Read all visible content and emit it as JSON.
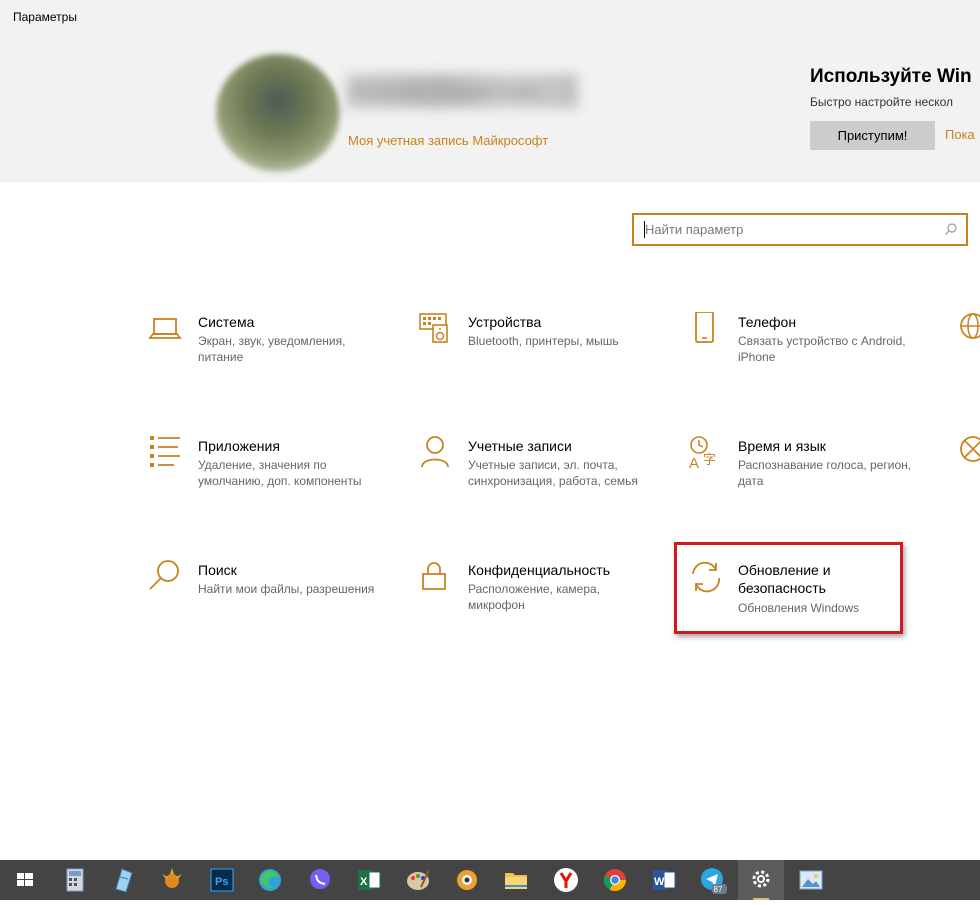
{
  "window": {
    "title": "Параметры"
  },
  "account": {
    "user_name": "Ксения Гаврилова",
    "link_label": "Моя учетная запись Майкрософт"
  },
  "promo": {
    "title": "Используйте Win",
    "subtitle": "Быстро настройте нескол",
    "start_button": "Приступим!",
    "later_link": "Пока"
  },
  "search": {
    "placeholder": "Найти параметр",
    "icon": "search-icon"
  },
  "tiles": [
    {
      "name": "Система",
      "desc": "Экран, звук, уведомления, питание",
      "icon": "laptop-icon"
    },
    {
      "name": "Устройства",
      "desc": "Bluetooth, принтеры, мышь",
      "icon": "keyboard-speaker-icon"
    },
    {
      "name": "Телефон",
      "desc": "Связать устройство с Android, iPhone",
      "icon": "phone-icon"
    },
    {
      "name": "Приложения",
      "desc": "Удаление, значения по умолчанию, доп. компоненты",
      "icon": "apps-list-icon"
    },
    {
      "name": "Учетные записи",
      "desc": "Учетные записи, эл. почта, синхронизация, работа, семья",
      "icon": "person-icon"
    },
    {
      "name": "Время и язык",
      "desc": "Распознавание голоса, регион, дата",
      "icon": "time-language-icon"
    },
    {
      "name": "Поиск",
      "desc": "Найти мои файлы, разрешения",
      "icon": "magnifier-icon"
    },
    {
      "name": "Конфиденциальность",
      "desc": "Расположение, камера, микрофон",
      "icon": "lock-icon"
    },
    {
      "name": "Обновление и безопасность",
      "desc": "Обновления Windows",
      "icon": "sync-icon"
    }
  ],
  "taskbar": {
    "items": [
      "windows-start-icon",
      "calculator-icon",
      "notepad-icon",
      "sun-app-icon",
      "photoshop-icon",
      "edge-icon",
      "viber-icon",
      "excel-icon",
      "paint-icon",
      "webcam-app-icon",
      "explorer-icon",
      "yandex-icon",
      "chrome-icon",
      "word-icon",
      "telegram-icon",
      "settings-icon",
      "image-viewer-icon"
    ],
    "telegram_badge": "87",
    "photoshop_label": "Ps",
    "word_label": "W",
    "excel_label": "X"
  },
  "colors": {
    "accent": "#c8821f",
    "highlight": "#d11a20",
    "taskbar": "#444444"
  }
}
